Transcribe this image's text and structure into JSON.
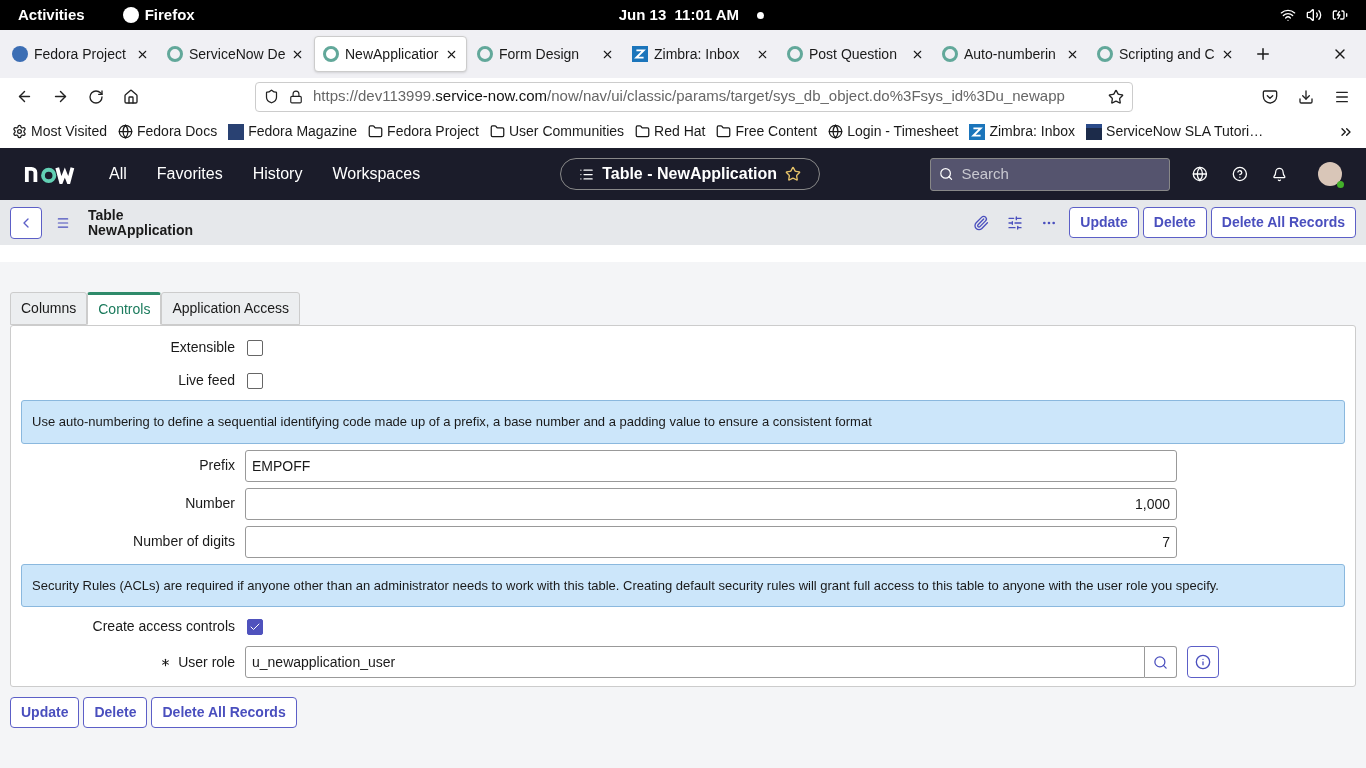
{
  "system_bar": {
    "activities": "Activities",
    "app": "Firefox",
    "clock": "Jun 13  11:01 AM"
  },
  "browser_tabs": [
    {
      "title": "Fedora Project",
      "kind": "fedora",
      "selected": false
    },
    {
      "title": "ServiceNow De",
      "kind": "servicenow",
      "selected": false
    },
    {
      "title": "NewApplicatior",
      "kind": "servicenow",
      "selected": true
    },
    {
      "title": "Form Design",
      "kind": "servicenow",
      "selected": false
    },
    {
      "title": "Zimbra: Inbox",
      "kind": "zimbra",
      "selected": false
    },
    {
      "title": "Post Question",
      "kind": "servicenow",
      "selected": false
    },
    {
      "title": "Auto-numberin",
      "kind": "servicenow",
      "selected": false
    },
    {
      "title": "Scripting and C",
      "kind": "servicenow",
      "selected": false
    }
  ],
  "address_bar": {
    "prefix": "https://dev113999.",
    "domain": "service-now.com",
    "path": "/now/nav/ui/classic/params/target/sys_db_object.do%3Fsys_id%3Du_newapp"
  },
  "bookmarks": [
    {
      "label": "Most Visited",
      "kind": "gear"
    },
    {
      "label": "Fedora Docs",
      "kind": "globe"
    },
    {
      "label": "Fedora Magazine",
      "kind": "fm"
    },
    {
      "label": "Fedora Project",
      "kind": "folder"
    },
    {
      "label": "User Communities",
      "kind": "folder"
    },
    {
      "label": "Red Hat",
      "kind": "folder"
    },
    {
      "label": "Free Content",
      "kind": "folder"
    },
    {
      "label": "Login - Timesheet",
      "kind": "globe"
    },
    {
      "label": "Zimbra: Inbox",
      "kind": "zimbra"
    },
    {
      "label": "ServiceNow SLA Tutori…",
      "kind": "sla"
    }
  ],
  "sn_header": {
    "nav": [
      "All",
      "Favorites",
      "History",
      "Workspaces"
    ],
    "title": "Table - NewApplication",
    "search_placeholder": "Search"
  },
  "record_header": {
    "type": "Table",
    "name": "NewApplication",
    "buttons": [
      "Update",
      "Delete",
      "Delete All Records"
    ]
  },
  "form_tabs": [
    {
      "label": "Columns",
      "selected": false
    },
    {
      "label": "Controls",
      "selected": true
    },
    {
      "label": "Application Access",
      "selected": false
    }
  ],
  "fields": [
    {
      "kind": "checkbox",
      "label": "Extensible",
      "checked": false
    },
    {
      "kind": "checkbox",
      "label": "Live feed",
      "checked": false
    },
    {
      "kind": "info",
      "text": "Use auto-numbering to define a sequential identifying code made up of a prefix, a base number and a padding value to ensure a consistent format"
    },
    {
      "kind": "text",
      "label": "Prefix",
      "value": "EMPOFF"
    },
    {
      "kind": "number",
      "label": "Number",
      "value": "1,000"
    },
    {
      "kind": "number",
      "label": "Number of digits",
      "value": "7"
    },
    {
      "kind": "info",
      "text": "Security Rules (ACLs) are required if anyone other than an administrator needs to work with this table. Creating default security rules will grant full access to this table to anyone with the user role you specify."
    },
    {
      "kind": "checkbox",
      "label": "Create access controls",
      "checked": true
    },
    {
      "kind": "reference",
      "label": "User role",
      "value": "u_newapplication_user",
      "mandatory": true
    }
  ],
  "bottom_buttons": [
    "Update",
    "Delete",
    "Delete All Records"
  ]
}
